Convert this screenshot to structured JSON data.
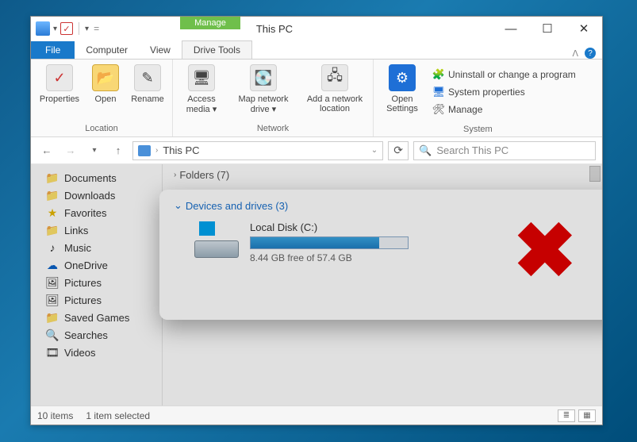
{
  "window": {
    "title": "This PC",
    "context_tab": "Manage",
    "context_group_bottom": "Drive Tools"
  },
  "tabs": {
    "file": "File",
    "computer": "Computer",
    "view": "View",
    "drive_tools": "Drive Tools"
  },
  "ribbon": {
    "location": {
      "properties": "Properties",
      "open": "Open",
      "rename": "Rename",
      "label": "Location"
    },
    "network": {
      "access_media": "Access media",
      "map_drive": "Map network drive",
      "add_location": "Add a network location",
      "label": "Network"
    },
    "system": {
      "open_settings": "Open Settings",
      "uninstall": "Uninstall or change a program",
      "sys_props": "System properties",
      "manage": "Manage",
      "label": "System"
    }
  },
  "addressbar": {
    "breadcrumb": "This PC",
    "search_placeholder": "Search This PC"
  },
  "sidebar": {
    "items": [
      {
        "icon": "folder",
        "label": "Documents"
      },
      {
        "icon": "folder",
        "label": "Downloads"
      },
      {
        "icon": "star",
        "label": "Favorites"
      },
      {
        "icon": "folder",
        "label": "Links"
      },
      {
        "icon": "music",
        "label": "Music"
      },
      {
        "icon": "cloud",
        "label": "OneDrive"
      },
      {
        "icon": "pictures",
        "label": "Pictures"
      },
      {
        "icon": "pictures",
        "label": "Pictures"
      },
      {
        "icon": "folder",
        "label": "Saved Games"
      },
      {
        "icon": "search",
        "label": "Searches"
      },
      {
        "icon": "video",
        "label": "Videos"
      }
    ]
  },
  "content": {
    "folders_header": "Folders (7)",
    "devices_header": "Devices and drives (3)",
    "drive": {
      "name": "Local Disk (C:)",
      "free_text": "8.44 GB free of 57.4 GB",
      "used_percent": 82
    }
  },
  "statusbar": {
    "items": "10 items",
    "selected": "1 item selected"
  },
  "icons": {
    "folder": "📁",
    "star": "★",
    "music": "♪",
    "cloud": "☁",
    "pictures": "🖼",
    "search": "🔍",
    "video": "🎞",
    "gear": "⚙",
    "check": "✓",
    "properties_check": "✓",
    "rename": "✎"
  }
}
